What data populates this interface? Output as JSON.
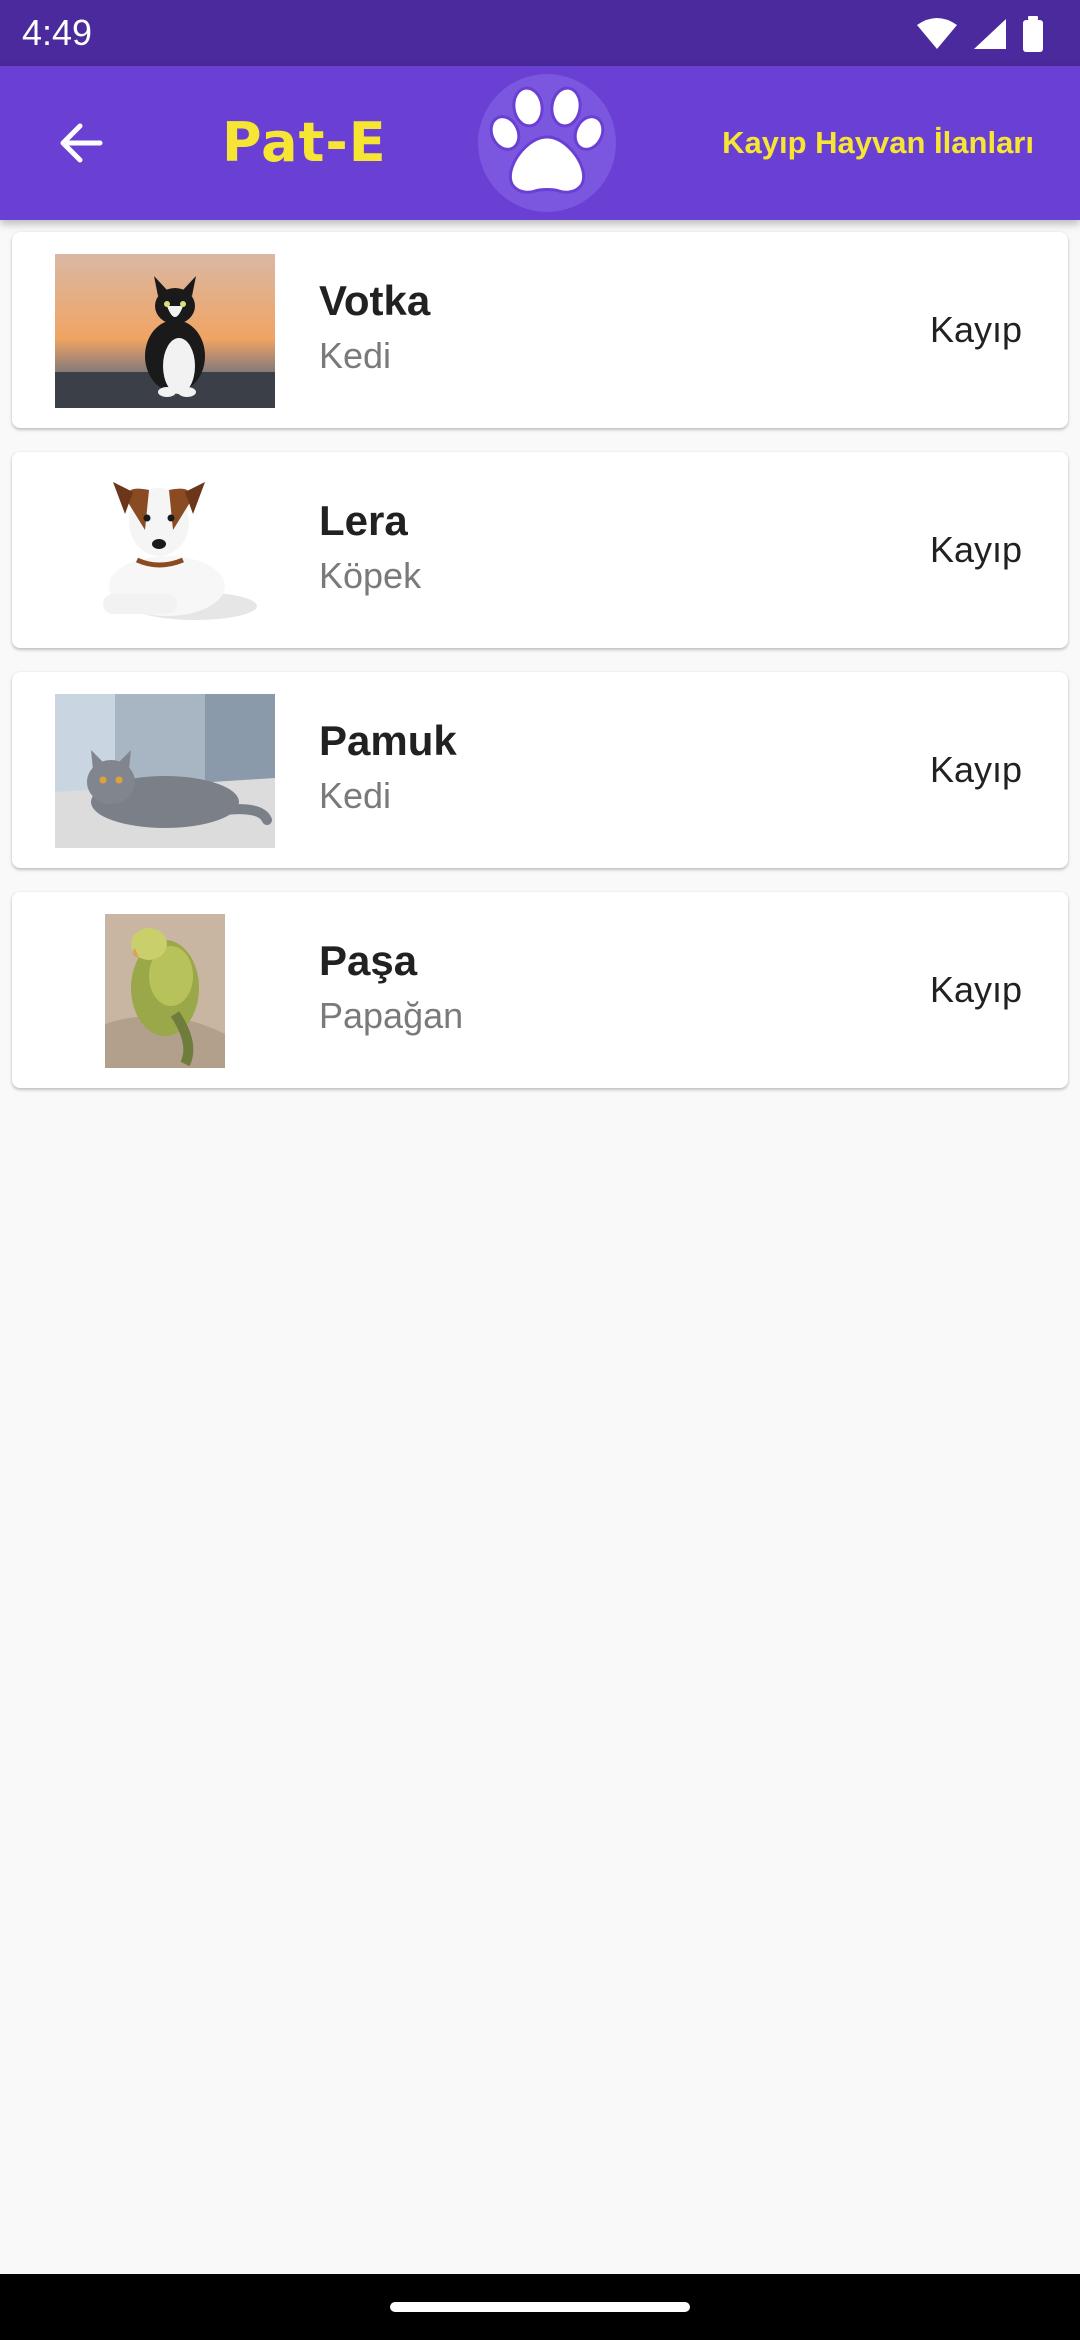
{
  "status_bar": {
    "time": "4:49",
    "icons": [
      "wifi-icon",
      "cellular-signal-icon",
      "battery-icon"
    ]
  },
  "app_bar": {
    "back_icon": "arrow-left-icon",
    "brand": "Pat-E",
    "logo_icon": "paw-icon",
    "title": "Kayıp Hayvan İlanları",
    "colors": {
      "background": "#6a3fd4",
      "accent": "#f6e633",
      "status_bar": "#4a2a9c"
    }
  },
  "pets": [
    {
      "name": "Votka",
      "type": "Kedi",
      "status": "Kayıp",
      "photo": "black-white-cat-photo"
    },
    {
      "name": "Lera",
      "type": "Köpek",
      "status": "Kayıp",
      "photo": "jack-russell-dog-photo"
    },
    {
      "name": "Pamuk",
      "type": "Kedi",
      "status": "Kayıp",
      "photo": "grey-british-cat-photo"
    },
    {
      "name": "Paşa",
      "type": "Papağan",
      "status": "Kayıp",
      "photo": "green-parrot-photo"
    }
  ]
}
